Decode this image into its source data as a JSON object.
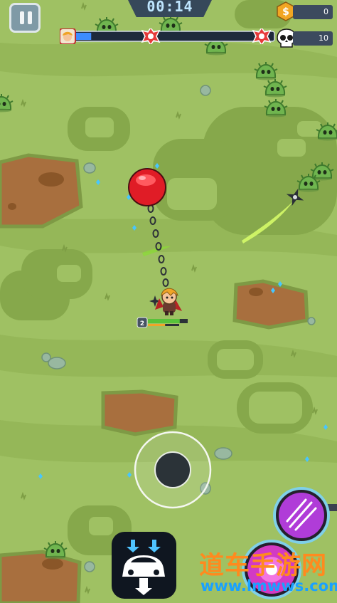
{
  "hud": {
    "timer": "00:14",
    "coins": "0",
    "kills": "10",
    "coin_symbol": "$",
    "level": "2",
    "wave_progress": 0.08,
    "player_health": 0.8,
    "player_xp": 0.55
  },
  "watermark": {
    "line1": "道车手游网",
    "line2": "www.lmwws.com"
  },
  "colors": {
    "grass": "#9fc163",
    "grass_dark": "#86a84b",
    "dirt": "#a86f3e",
    "ball": "#e01c26",
    "enemy": "#6fb54f",
    "gem": "#47c6ff"
  },
  "skills": {
    "claw_skill": "claw-icon",
    "orb_skill": "orb-icon",
    "drive_skill": "car-icon"
  }
}
